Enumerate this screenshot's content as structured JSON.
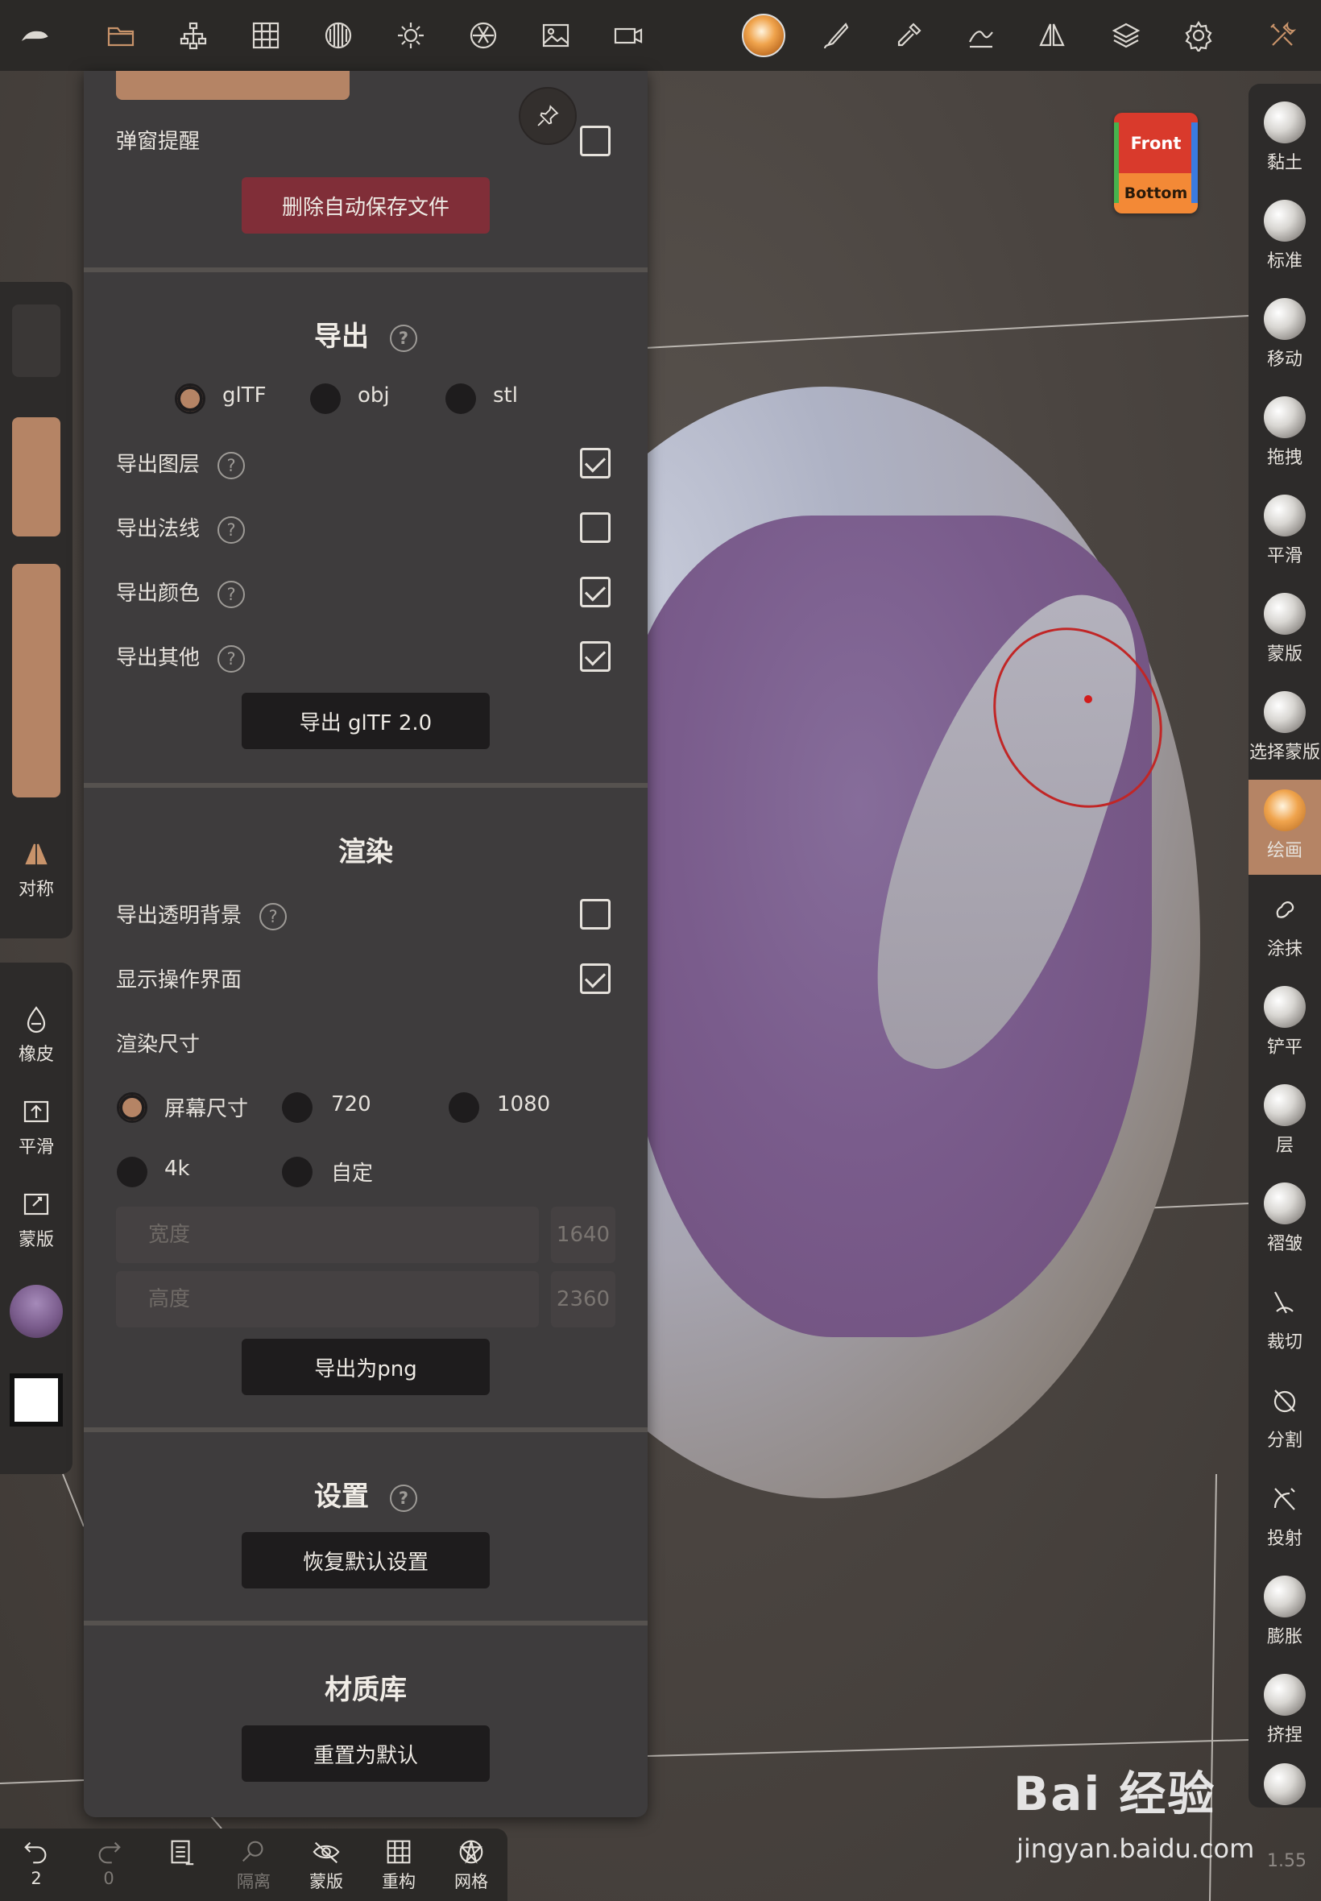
{
  "top_toolbar": {
    "icons": [
      "logo-icon",
      "folder-icon",
      "scene-tree-icon",
      "grid-icon",
      "sphere-icon",
      "sun-icon",
      "aperture-icon",
      "image-icon",
      "camera-icon",
      "material-ball-icon",
      "brush-icon",
      "picker-icon",
      "stroke-icon",
      "symmetry-icon",
      "layers-icon",
      "settings-icon",
      "tools-icon"
    ]
  },
  "viewcube": {
    "front": "Front",
    "bottom": "Bottom"
  },
  "panel": {
    "popup_label": "弹窗提醒",
    "popup_checked": false,
    "delete_autosave": "删除自动保存文件",
    "export": {
      "title": "导出",
      "formats": [
        "glTF",
        "obj",
        "stl"
      ],
      "selected_format": "glTF",
      "options": [
        {
          "label": "导出图层",
          "checked": true
        },
        {
          "label": "导出法线",
          "checked": false
        },
        {
          "label": "导出颜色",
          "checked": true
        },
        {
          "label": "导出其他",
          "checked": true
        }
      ],
      "button": "导出 glTF 2.0"
    },
    "render": {
      "title": "渲染",
      "transparent_bg": "导出透明背景",
      "transparent_checked": false,
      "show_ui": "显示操作界面",
      "show_ui_checked": true,
      "size_label": "渲染尺寸",
      "sizes": [
        "屏幕尺寸",
        "720",
        "1080",
        "4k",
        "自定"
      ],
      "selected_size": "屏幕尺寸",
      "width_label": "宽度",
      "width_value": "1640",
      "height_label": "高度",
      "height_value": "2360",
      "button": "导出为png"
    },
    "settings": {
      "title": "设置",
      "button": "恢复默认设置"
    },
    "materials": {
      "title": "材质库",
      "button": "重置为默认"
    }
  },
  "left_panel": {
    "symmetry": "对称",
    "eraser": "橡皮",
    "smooth": "平滑",
    "mask": "蒙版",
    "color_swatch": "#7a5c8c"
  },
  "right_tools": [
    {
      "label": "黏土",
      "active": false
    },
    {
      "label": "标准",
      "active": false
    },
    {
      "label": "移动",
      "active": false
    },
    {
      "label": "拖拽",
      "active": false
    },
    {
      "label": "平滑",
      "active": false
    },
    {
      "label": "蒙版",
      "active": false
    },
    {
      "label": "选择蒙版",
      "active": false
    },
    {
      "label": "绘画",
      "active": true
    },
    {
      "label": "涂抹",
      "active": false
    },
    {
      "label": "铲平",
      "active": false
    },
    {
      "label": "层",
      "active": false
    },
    {
      "label": "褶皱",
      "active": false
    },
    {
      "label": "裁切",
      "active": false
    },
    {
      "label": "分割",
      "active": false
    },
    {
      "label": "投射",
      "active": false
    },
    {
      "label": "膨胀",
      "active": false
    },
    {
      "label": "挤捏",
      "active": false
    }
  ],
  "bottom_bar": {
    "undo_count": "2",
    "redo_count": "0",
    "isolate": "隔离",
    "mask": "蒙版",
    "remesh": "重构",
    "wireframe": "网格"
  },
  "watermark": {
    "brand": "Bai 经验",
    "url": "jingyan.baidu.com"
  },
  "version": "1.55",
  "colors": {
    "accent": "#b58465",
    "danger": "#802e38",
    "paint": "#7a5c8c"
  }
}
